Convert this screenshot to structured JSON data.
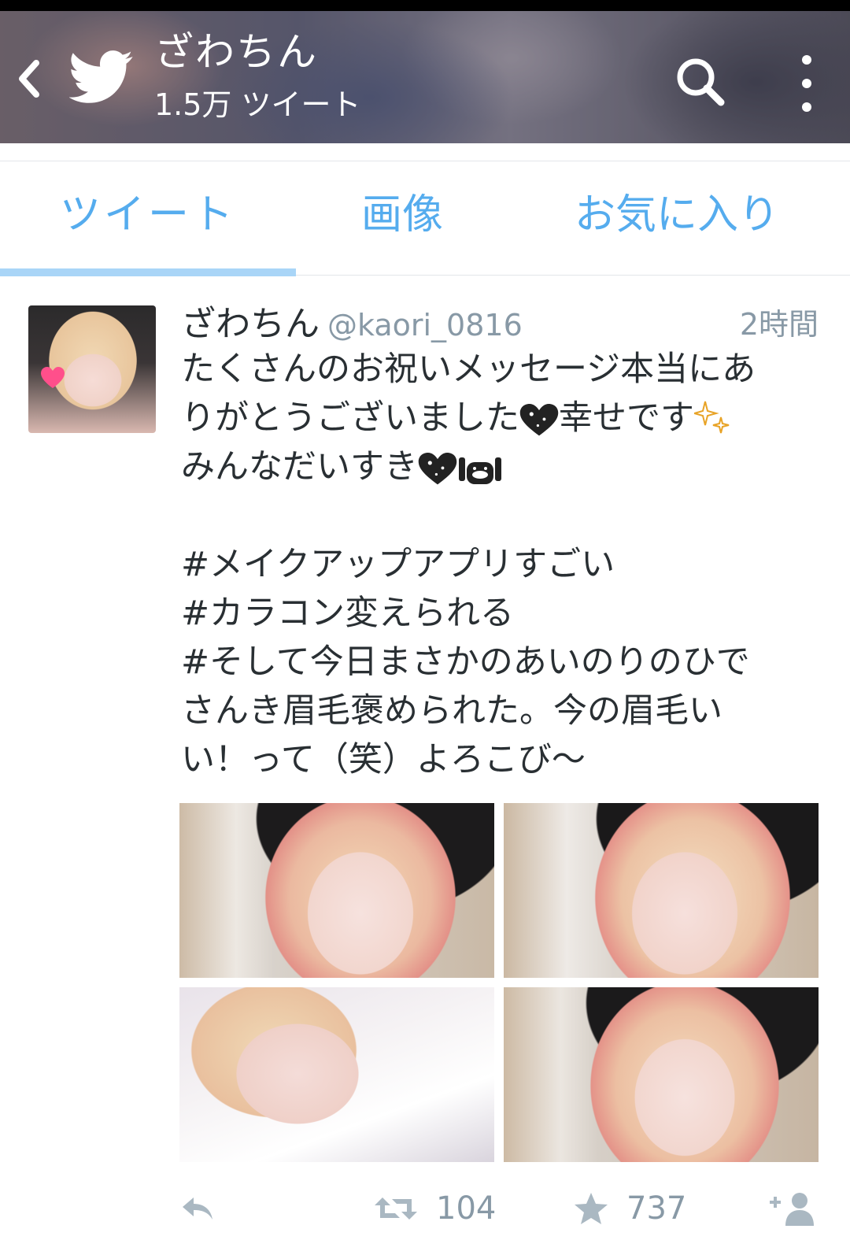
{
  "header": {
    "name": "ざわちん",
    "tweet_count": "1.5万 ツイート",
    "back_icon": "back-chevron-icon",
    "logo_icon": "twitter-bird-icon",
    "search_icon": "search-icon",
    "more_icon": "more-vertical-icon"
  },
  "tabs": [
    {
      "label": "ツイート",
      "active": true
    },
    {
      "label": "画像",
      "active": false
    },
    {
      "label": "お気に入り",
      "active": false
    }
  ],
  "tweet": {
    "author": "ざわちん",
    "handle": "@kaori_0816",
    "time": "2時間",
    "text_line1": "たくさんのお祝いメッセージ本当にあ",
    "text_line2a": "りがとうございました",
    "text_line2b": "幸せです",
    "text_line3": "みんなだいすき",
    "hashtag_lines": [
      "#メイクアップアプリすごい",
      "#カラコン変えられる",
      "#そして今日まさかのあいのりのひで",
      "さんき眉毛褒められた。今の眉毛い",
      "い！って（笑）よろこび〜"
    ],
    "photos": [
      "photo-1",
      "photo-2",
      "photo-3",
      "photo-4"
    ],
    "retweets": "104",
    "favorites": "737"
  },
  "colors": {
    "accent": "#55acee",
    "tab_underline": "#a9d5f7",
    "text": "#292f33",
    "muted": "#8899a6"
  }
}
